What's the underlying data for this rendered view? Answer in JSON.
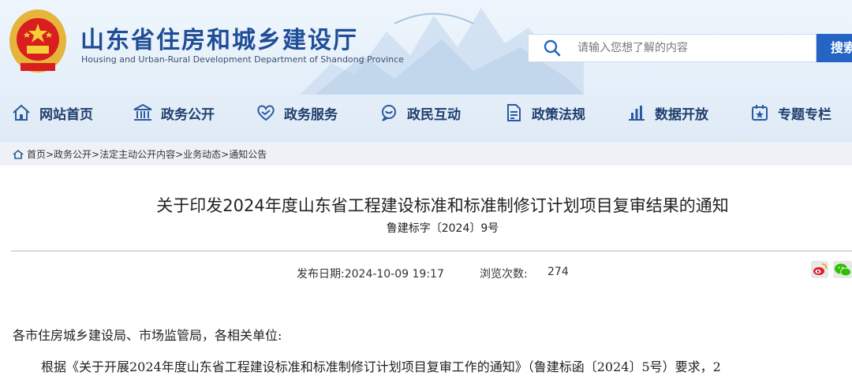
{
  "header": {
    "site_title": "山东省住房和城乡建设厅",
    "site_subtitle": "Housing and Urban-Rural Development Department of Shandong Province",
    "emblem_icon": "national-emblem-icon",
    "search": {
      "placeholder": "请输入您想了解的内容",
      "button_label": "搜索"
    }
  },
  "nav": {
    "items": [
      {
        "label": "网站首页",
        "icon": "home-icon"
      },
      {
        "label": "政务公开",
        "icon": "government-building-icon"
      },
      {
        "label": "政务服务",
        "icon": "handshake-heart-icon"
      },
      {
        "label": "政民互动",
        "icon": "chat-bubble-icon"
      },
      {
        "label": "政策法规",
        "icon": "document-icon"
      },
      {
        "label": "数据开放",
        "icon": "bar-chart-icon"
      },
      {
        "label": "专题专栏",
        "icon": "calendar-star-icon"
      }
    ]
  },
  "breadcrumb": {
    "text": "首页>政务公开>法定主动公开内容>业务动态>通知公告"
  },
  "article": {
    "title": "关于印发2024年度山东省工程建设标准和标准制修订计划项目复审结果的通知",
    "doc_number": "鲁建标字〔2024〕9号",
    "publish_date": "发布日期:2024-10-09 19:17",
    "views_label": "浏览次数:",
    "views": "274",
    "share_icons": [
      "weibo-icon",
      "wechat-icon"
    ],
    "salutation": "各市住房城乡建设局、市场监管局，各相关单位:",
    "paragraph_1": "根据《关于开展2024年度山东省工程建设标准和标准制修订计划项目复审工作的通知》（鲁建标函〔2024〕5号）要求，2"
  },
  "colors": {
    "title_blue": "#1f4e96",
    "search_button": "#2464c4",
    "nav_text": "#1f3e6e"
  }
}
